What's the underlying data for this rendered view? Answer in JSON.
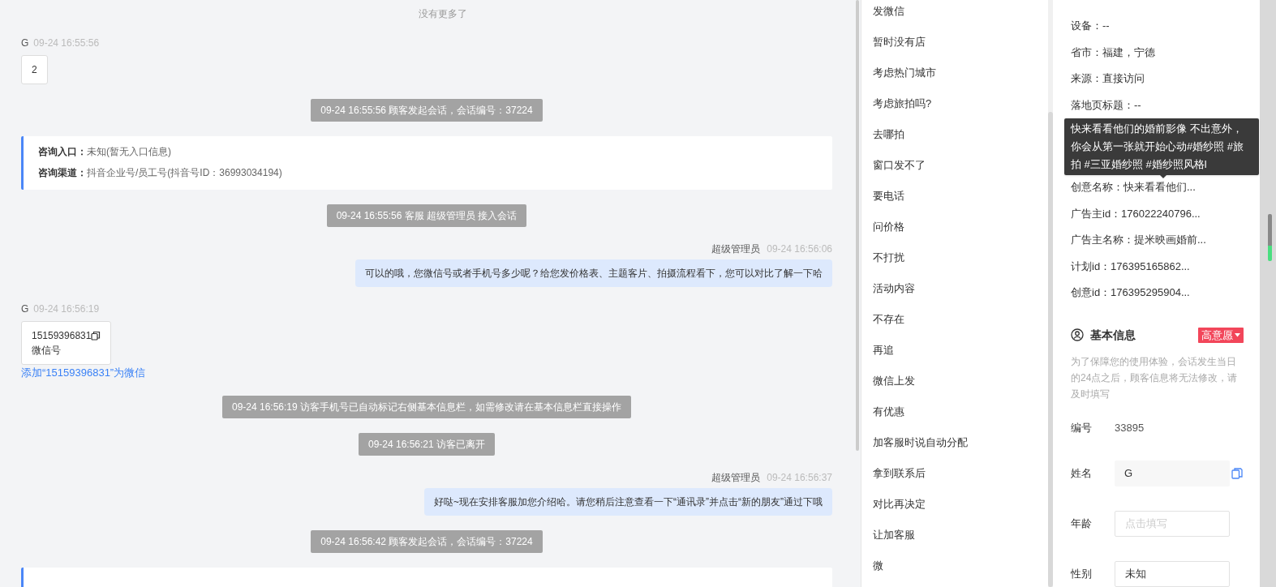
{
  "chat": {
    "end_note": "没有更多了",
    "messages": [
      {
        "kind": "visitor_text",
        "name": "G",
        "time": "09-24 16:55:56",
        "text": "2"
      },
      {
        "kind": "system",
        "text": "09-24 16:55:56 顾客发起会话，会话编号：37224"
      },
      {
        "kind": "entry_card",
        "lines": [
          {
            "label": "咨询入口：",
            "value": "未知(暂无入口信息)"
          },
          {
            "label": "咨询渠道：",
            "value": "抖音企业号/员工号(抖音号ID：36993034194)"
          }
        ]
      },
      {
        "kind": "system",
        "text": "09-24 16:55:56 客服 超级管理员 接入会话"
      },
      {
        "kind": "agent_text",
        "name": "超级管理员",
        "time": "09-24 16:56:06",
        "text": "可以的哦，您微信号或者手机号多少呢？给您发价格表、主题客片、拍摄流程看下，您可以对比了解一下哈"
      },
      {
        "kind": "visitor_contact",
        "name": "G",
        "time": "09-24 16:56:19",
        "number": "15159396831",
        "type": "微信号",
        "link": "添加“15159396831”为微信"
      },
      {
        "kind": "system",
        "text": "09-24 16:56:19 访客手机号已自动标记右侧基本信息栏，如需修改请在基本信息栏直接操作"
      },
      {
        "kind": "system",
        "text": "09-24 16:56:21 访客已离开"
      },
      {
        "kind": "agent_text",
        "name": "超级管理员",
        "time": "09-24 16:56:37",
        "text": "好哒~现在安排客服加您介绍哈。请您稍后注意查看一下“通讯录”并点击“新的朋友”通过下哦"
      },
      {
        "kind": "system",
        "text": "09-24 16:56:42 顾客发起会话，会话编号：37224"
      },
      {
        "kind": "entry_card"
      }
    ]
  },
  "quick_replies": [
    "发微信",
    "暂时没有店",
    "考虑热门城市",
    "考虑旅拍吗?",
    "去哪拍",
    "窗口发不了",
    "要电话",
    "问价格",
    "不打扰",
    "活动内容",
    "不存在",
    "再追",
    "微信上发",
    "有优惠",
    "加客服时说自动分配",
    "拿到联系后",
    "对比再决定",
    "让加客服",
    "微"
  ],
  "visit_info": {
    "rows_top": [
      "设备：--",
      "省市：福建，宁德",
      "来源：直接访问",
      "落地页标题：--"
    ],
    "tooltip": "快来看看他们的婚前影像 不出意外，你会从第一张就开始心动#婚纱照 #旅拍 #三亚婚纱照 #婚纱照风格l",
    "rows_bottom": [
      "创意名称：快来看看他们...",
      "广告主id：176022240796...",
      "广告主名称：提米映画婚前...",
      "计划id：176395165862...",
      "创意id：176395295904..."
    ]
  },
  "basic_info": {
    "title": "基本信息",
    "intent": "高意愿",
    "notice": "为了保障您的使用体验，会话发生当日的24点之后，顾客信息将无法修改，请及时填写",
    "fields": [
      {
        "kind": "static",
        "label": "编号",
        "value": "33895"
      },
      {
        "kind": "readonly",
        "label": "姓名",
        "value": "G"
      },
      {
        "kind": "input",
        "label": "年龄",
        "placeholder": "点击填写"
      },
      {
        "kind": "input",
        "label": "性别",
        "value": "未知"
      }
    ]
  }
}
